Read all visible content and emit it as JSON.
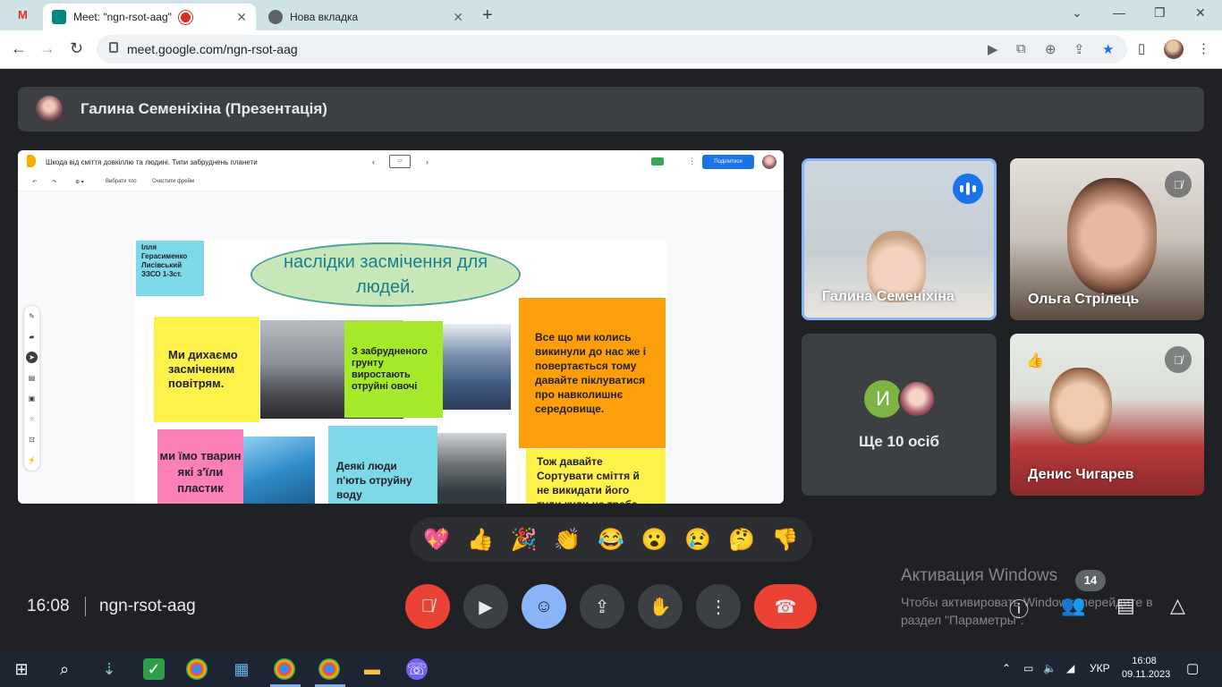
{
  "browser": {
    "tabs": [
      {
        "title": "Meet: \"ngn-rsot-aag\"",
        "active": true
      },
      {
        "title": "Нова вкладка",
        "active": false
      }
    ],
    "url": "meet.google.com/ngn-rsot-aag"
  },
  "meet": {
    "presenter_label": "Галина Семеніхіна (Презентація)",
    "clock": "16:08",
    "meeting_code": "ngn-rsot-aag",
    "participants": [
      {
        "name": "Галина Семеніхіна",
        "state": "speaking"
      },
      {
        "name": "Ольга Стрілець",
        "state": "muted"
      },
      {
        "name": "Денис Чигарев",
        "state": "muted",
        "reaction": "👍"
      }
    ],
    "more_tile": {
      "initial": "И",
      "label": "Ще 10 осіб"
    },
    "reactions": [
      "💖",
      "👍",
      "🎉",
      "👏",
      "😂",
      "😮",
      "😢",
      "🤔",
      "👎"
    ],
    "participant_count": "14",
    "accent_color": "#8ab4f8",
    "hangup_color": "#ea4335"
  },
  "jamboard": {
    "title": "Шкода від сміття довкіллю та людині. Типи забруднень планети",
    "share_label": "Поділитися",
    "tool_set_background": "Вибрати тло",
    "tool_clear_frame": "Очистити фрейм",
    "slide": {
      "author": "Ілля Герасименко Лисівський ЗЗСО 1-3ст.",
      "title": "наслідки засмічення для людей.",
      "notes": {
        "air": "Ми дихаємо засміченим повітрям.",
        "soil": "З забрудненого грунту виростають отруйні овочі",
        "return": "Все що ми колись викинули до нас же і повертається тому давайте піклуватися про навколишнє середовище.",
        "animals": "ми їмо тварин які з'їли пластик",
        "water": "Деякі люди п'ють отруйну воду",
        "sort": "Тож давайте Сортувати сміття й не викидати його туди куди не треба."
      }
    }
  },
  "windows": {
    "watermark_title": "Активация Windows",
    "watermark_text": "Чтобы активировать Windows, перейдите в раздел \"Параметры\".",
    "tray_lang": "УКР",
    "tray_time": "16:08",
    "tray_date": "09.11.2023"
  }
}
